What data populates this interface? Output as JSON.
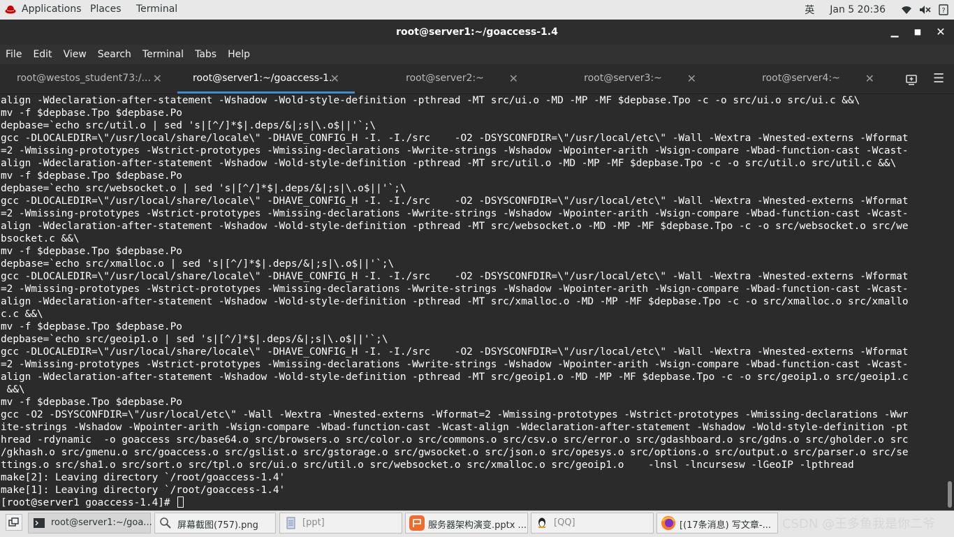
{
  "topbar": {
    "applications": "Applications",
    "places": "Places",
    "terminal": "Terminal",
    "input_method": "英",
    "datetime": "Jan 5  20:36"
  },
  "window": {
    "title": "root@server1:~/goaccess-1.4"
  },
  "menubar": {
    "items": [
      "File",
      "Edit",
      "View",
      "Search",
      "Terminal",
      "Tabs",
      "Help"
    ]
  },
  "tabs": [
    {
      "label": "root@westos_student73:/..."
    },
    {
      "label": "root@server1:~/goaccess-1..."
    },
    {
      "label": "root@server2:~"
    },
    {
      "label": "root@server3:~"
    },
    {
      "label": "root@server4:~"
    }
  ],
  "terminal_lines": [
    "align -Wdeclaration-after-statement -Wshadow -Wold-style-definition -pthread -MT src/ui.o -MD -MP -MF $depbase.Tpo -c -o src/ui.o src/ui.c &&\\",
    "mv -f $depbase.Tpo $depbase.Po",
    "depbase=`echo src/util.o | sed 's|[^/]*$|.deps/&|;s|\\.o$||'`;\\",
    "gcc -DLOCALEDIR=\\\"/usr/local/share/locale\\\" -DHAVE_CONFIG_H -I. -I./src    -O2 -DSYSCONFDIR=\\\"/usr/local/etc\\\" -Wall -Wextra -Wnested-externs -Wformat",
    "=2 -Wmissing-prototypes -Wstrict-prototypes -Wmissing-declarations -Wwrite-strings -Wshadow -Wpointer-arith -Wsign-compare -Wbad-function-cast -Wcast-",
    "align -Wdeclaration-after-statement -Wshadow -Wold-style-definition -pthread -MT src/util.o -MD -MP -MF $depbase.Tpo -c -o src/util.o src/util.c &&\\",
    "mv -f $depbase.Tpo $depbase.Po",
    "depbase=`echo src/websocket.o | sed 's|[^/]*$|.deps/&|;s|\\.o$||'`;\\",
    "gcc -DLOCALEDIR=\\\"/usr/local/share/locale\\\" -DHAVE_CONFIG_H -I. -I./src    -O2 -DSYSCONFDIR=\\\"/usr/local/etc\\\" -Wall -Wextra -Wnested-externs -Wformat",
    "=2 -Wmissing-prototypes -Wstrict-prototypes -Wmissing-declarations -Wwrite-strings -Wshadow -Wpointer-arith -Wsign-compare -Wbad-function-cast -Wcast-",
    "align -Wdeclaration-after-statement -Wshadow -Wold-style-definition -pthread -MT src/websocket.o -MD -MP -MF $depbase.Tpo -c -o src/websocket.o src/we",
    "bsocket.c &&\\",
    "mv -f $depbase.Tpo $depbase.Po",
    "depbase=`echo src/xmalloc.o | sed 's|[^/]*$|.deps/&|;s|\\.o$||'`;\\",
    "gcc -DLOCALEDIR=\\\"/usr/local/share/locale\\\" -DHAVE_CONFIG_H -I. -I./src    -O2 -DSYSCONFDIR=\\\"/usr/local/etc\\\" -Wall -Wextra -Wnested-externs -Wformat",
    "=2 -Wmissing-prototypes -Wstrict-prototypes -Wmissing-declarations -Wwrite-strings -Wshadow -Wpointer-arith -Wsign-compare -Wbad-function-cast -Wcast-",
    "align -Wdeclaration-after-statement -Wshadow -Wold-style-definition -pthread -MT src/xmalloc.o -MD -MP -MF $depbase.Tpo -c -o src/xmalloc.o src/xmallo",
    "c.c &&\\",
    "mv -f $depbase.Tpo $depbase.Po",
    "depbase=`echo src/geoip1.o | sed 's|[^/]*$|.deps/&|;s|\\.o$||'`;\\",
    "gcc -DLOCALEDIR=\\\"/usr/local/share/locale\\\" -DHAVE_CONFIG_H -I. -I./src    -O2 -DSYSCONFDIR=\\\"/usr/local/etc\\\" -Wall -Wextra -Wnested-externs -Wformat",
    "=2 -Wmissing-prototypes -Wstrict-prototypes -Wmissing-declarations -Wwrite-strings -Wshadow -Wpointer-arith -Wsign-compare -Wbad-function-cast -Wcast-",
    "align -Wdeclaration-after-statement -Wshadow -Wold-style-definition -pthread -MT src/geoip1.o -MD -MP -MF $depbase.Tpo -c -o src/geoip1.o src/geoip1.c",
    " &&\\",
    "mv -f $depbase.Tpo $depbase.Po",
    "gcc -O2 -DSYSCONFDIR=\\\"/usr/local/etc\\\" -Wall -Wextra -Wnested-externs -Wformat=2 -Wmissing-prototypes -Wstrict-prototypes -Wmissing-declarations -Wwr",
    "ite-strings -Wshadow -Wpointer-arith -Wsign-compare -Wbad-function-cast -Wcast-align -Wdeclaration-after-statement -Wshadow -Wold-style-definition -pt",
    "hread -rdynamic  -o goaccess src/base64.o src/browsers.o src/color.o src/commons.o src/csv.o src/error.o src/gdashboard.o src/gdns.o src/gholder.o src",
    "/gkhash.o src/gmenu.o src/goaccess.o src/gslist.o src/gstorage.o src/gwsocket.o src/json.o src/opesys.o src/options.o src/output.o src/parser.o src/se",
    "ttings.o src/sha1.o src/sort.o src/tpl.o src/ui.o src/util.o src/websocket.o src/xmalloc.o src/geoip1.o    -lnsl -lncursesw -lGeoIP -lpthread",
    "make[2]: Leaving directory `/root/goaccess-1.4'",
    "make[1]: Leaving directory `/root/goaccess-1.4'"
  ],
  "prompt": "[root@server1 goaccess-1.4]# ",
  "taskbar": {
    "items": [
      {
        "label": "root@server1:~/goa...",
        "icon": "terminal-icon"
      },
      {
        "label": "屏幕截图(757).png",
        "icon": "image-viewer-icon"
      },
      {
        "label": "[ppt]",
        "icon": "document-icon"
      },
      {
        "label": "服务器架构演变.pptx ...",
        "icon": "presentation-icon"
      },
      {
        "label": "[QQ]",
        "icon": "qq-icon"
      },
      {
        "label": "[(17条消息) 写文章-...",
        "icon": "firefox-icon"
      }
    ]
  },
  "watermark": "CSDN @王多鱼我是你二爷",
  "colors": {
    "terminal_bg": "#2b2b2b",
    "terminal_fg": "#ffffff",
    "active_tab_underline": "#3d8fd1",
    "topbar_bg": "#e8e8e8"
  }
}
